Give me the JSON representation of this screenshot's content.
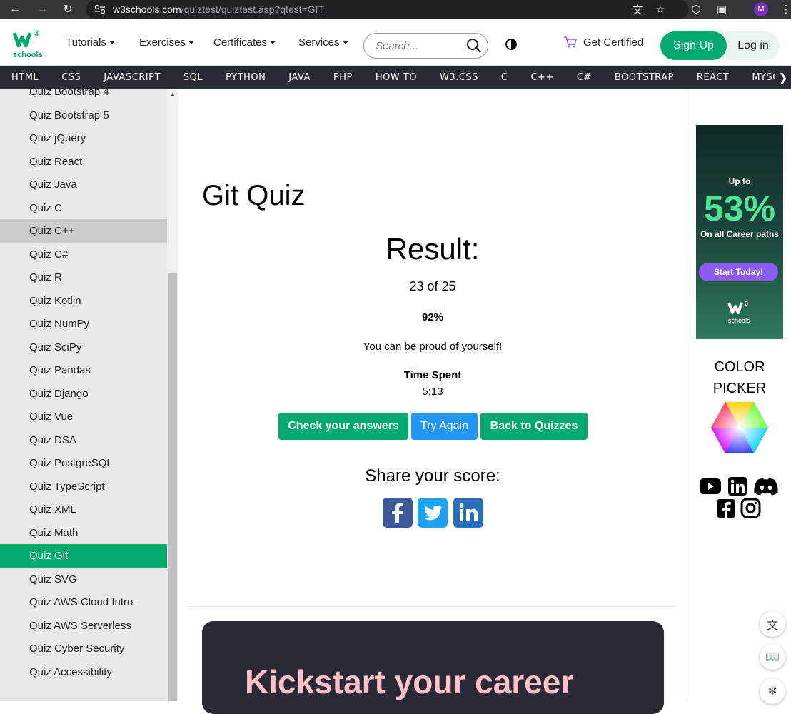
{
  "browser": {
    "url_domain": "w3schools.com",
    "url_path": "/quiztest/quiztest.asp?qtest=GIT",
    "avatar_letter": "M"
  },
  "topnav": {
    "logo_text": "schools",
    "logo_sup": "3",
    "menu": [
      "Tutorials",
      "Exercises",
      "Certificates",
      "Services"
    ],
    "search_placeholder": "Search...",
    "get_certified": "Get Certified",
    "sign_up": "Sign Up",
    "log_in": "Log in"
  },
  "langbar": [
    "HTML",
    "CSS",
    "JAVASCRIPT",
    "SQL",
    "PYTHON",
    "JAVA",
    "PHP",
    "HOW TO",
    "W3.CSS",
    "C",
    "C++",
    "C#",
    "BOOTSTRAP",
    "REACT",
    "MYSQL"
  ],
  "sidebar": {
    "items": [
      "Quiz Bootstrap 4",
      "Quiz Bootstrap 5",
      "Quiz jQuery",
      "Quiz React",
      "Quiz Java",
      "Quiz C",
      "Quiz C++",
      "Quiz C#",
      "Quiz R",
      "Quiz Kotlin",
      "Quiz NumPy",
      "Quiz SciPy",
      "Quiz Pandas",
      "Quiz Django",
      "Quiz Vue",
      "Quiz DSA",
      "Quiz PostgreSQL",
      "Quiz TypeScript",
      "Quiz XML",
      "Quiz Math",
      "Quiz Git",
      "Quiz SVG",
      "Quiz AWS Cloud Intro",
      "Quiz AWS Serverless",
      "Quiz Cyber Security",
      "Quiz Accessibility"
    ],
    "hovered": "Quiz C++",
    "active": "Quiz Git"
  },
  "main": {
    "title": "Git Quiz",
    "result_label": "Result:",
    "score_text": "23 of 25",
    "percent": "92%",
    "message": "You can be proud of yourself!",
    "time_label": "Time Spent",
    "time_value": "5:13",
    "buttons": {
      "check": "Check your answers",
      "try_again": "Try Again",
      "back": "Back to Quizzes"
    },
    "share_label": "Share your score:",
    "banner_text": "Kickstart your career"
  },
  "right": {
    "ad": {
      "up_to": "Up to",
      "big": "53%",
      "sub": "On all Career paths",
      "cta": "Start Today!",
      "logo_text": "schools"
    },
    "color_picker": [
      "COLOR",
      "PICKER"
    ]
  },
  "colors": {
    "brand_green": "#04aa6d",
    "blue": "#2196f3",
    "dark": "#282a35"
  }
}
